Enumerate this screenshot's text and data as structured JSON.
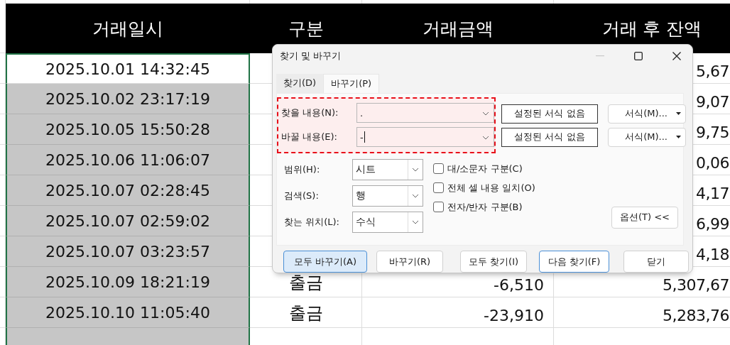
{
  "sheet": {
    "headers": [
      "거래일시",
      "구분",
      "거래금액",
      "거래 후 잔액"
    ],
    "rows": [
      {
        "datetime": "2025.10.01 14:32:45",
        "balance": "5,67",
        "selected": false
      },
      {
        "datetime": "2025.10.02 23:17:19",
        "balance": "9,07",
        "selected": true
      },
      {
        "datetime": "2025.10.05 15:50:28",
        "balance": "9,75",
        "selected": true
      },
      {
        "datetime": "2025.10.06 11:06:07",
        "balance": "0,06",
        "selected": true
      },
      {
        "datetime": "2025.10.07 02:28:45",
        "balance": "4,17",
        "selected": true
      },
      {
        "datetime": "2025.10.07 02:59:02",
        "balance": "6,99",
        "selected": true
      },
      {
        "datetime": "2025.10.07 03:23:57",
        "balance": "4,18",
        "selected": true
      },
      {
        "datetime": "2025.10.09 18:21:19",
        "type": "출금",
        "amount": "-6,510",
        "balance": "5,307,67",
        "selected": true
      },
      {
        "datetime": "2025.10.10 11:05:40",
        "type": "출금",
        "amount": "-23,910",
        "balance": "5,283,76",
        "selected": true
      }
    ]
  },
  "dialog": {
    "title": "찾기 및 바꾸기",
    "tabs": [
      {
        "label": "찾기(D)",
        "selected": false
      },
      {
        "label": "바꾸기(P)",
        "selected": true
      }
    ],
    "fields": [
      {
        "label": "찾을 내용(N):",
        "value": ".",
        "cursor": false,
        "format_status": "설정된 서식 없음",
        "format_button": "서식(M)..."
      },
      {
        "label": "바꿀 내용(E):",
        "value": "-",
        "cursor": true,
        "format_status": "설정된 서식 없음",
        "format_button": "서식(M)..."
      }
    ],
    "combos": [
      {
        "label": "범위(H):",
        "value": "시트"
      },
      {
        "label": "검색(S):",
        "value": "행"
      },
      {
        "label": "찾는 위치(L):",
        "value": "수식"
      }
    ],
    "checkboxes": [
      {
        "label": "대/소문자 구분(C)",
        "checked": false
      },
      {
        "label": "전체 셀 내용 일치(O)",
        "checked": false
      },
      {
        "label": "전자/반자 구분(B)",
        "checked": false
      }
    ],
    "options_button": "옵션(T) <<",
    "buttons": [
      {
        "label": "모두 바꾸기(A)",
        "kind": "focused"
      },
      {
        "label": "바꾸기(R)",
        "kind": "normal"
      },
      {
        "label": "모두 찾기(I)",
        "kind": "normal"
      },
      {
        "label": "다음 찾기(F)",
        "kind": "default"
      },
      {
        "label": "닫기",
        "kind": "normal"
      }
    ]
  }
}
